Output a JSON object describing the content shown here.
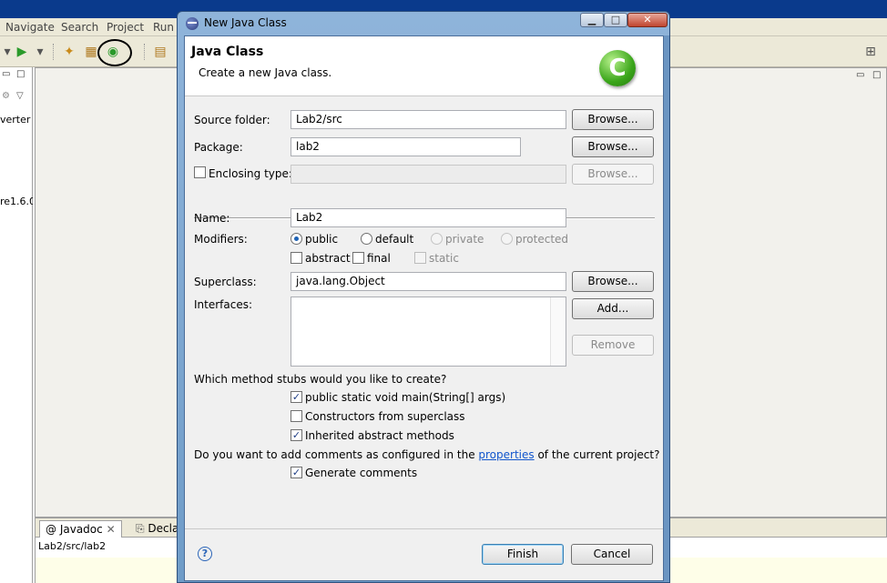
{
  "background": {
    "menu": [
      "Navigate",
      "Search",
      "Project",
      "Run"
    ],
    "left_pane_items": [
      "verter",
      "re1.6.0"
    ],
    "bottom_tabs": [
      {
        "label": "Javadoc",
        "icon": "at-icon"
      },
      {
        "label": "Decla",
        "icon": "declaration-icon"
      }
    ],
    "path": "Lab2/src/lab2"
  },
  "dialog": {
    "title": "New Java Class",
    "header_title": "Java Class",
    "header_subtitle": "Create a new Java class.",
    "logo_letter": "C",
    "source_folder": {
      "label": "Source folder:",
      "value": "Lab2/src",
      "button": "Browse..."
    },
    "package": {
      "label": "Package:",
      "value": "lab2",
      "button": "Browse..."
    },
    "enclosing": {
      "label": "Enclosing type:",
      "value": "",
      "button": "Browse...",
      "checked": false
    },
    "name": {
      "label": "Name:",
      "value": "Lab2"
    },
    "modifiers": {
      "label": "Modifiers:",
      "access": [
        {
          "label": "public",
          "checked": true,
          "enabled": true
        },
        {
          "label": "default",
          "checked": false,
          "enabled": true
        },
        {
          "label": "private",
          "checked": false,
          "enabled": false
        },
        {
          "label": "protected",
          "checked": false,
          "enabled": false
        }
      ],
      "flags": [
        {
          "label": "abstract",
          "checked": false,
          "enabled": true
        },
        {
          "label": "final",
          "checked": false,
          "enabled": true
        },
        {
          "label": "static",
          "checked": false,
          "enabled": false
        }
      ]
    },
    "superclass": {
      "label": "Superclass:",
      "value": "java.lang.Object",
      "button": "Browse..."
    },
    "interfaces": {
      "label": "Interfaces:",
      "add_button": "Add...",
      "remove_button": "Remove"
    },
    "stubs": {
      "question": "Which method stubs would you like to create?",
      "options": [
        {
          "label": "public static void main(String[] args)",
          "checked": true
        },
        {
          "label": "Constructors from superclass",
          "checked": false
        },
        {
          "label": "Inherited abstract methods",
          "checked": true
        }
      ]
    },
    "comments": {
      "question_prefix": "Do you want to add comments as configured in the ",
      "link": "properties",
      "question_suffix": " of the current project?",
      "option": {
        "label": "Generate comments",
        "checked": true
      }
    },
    "finish_button": "Finish",
    "cancel_button": "Cancel",
    "help_symbol": "?"
  }
}
